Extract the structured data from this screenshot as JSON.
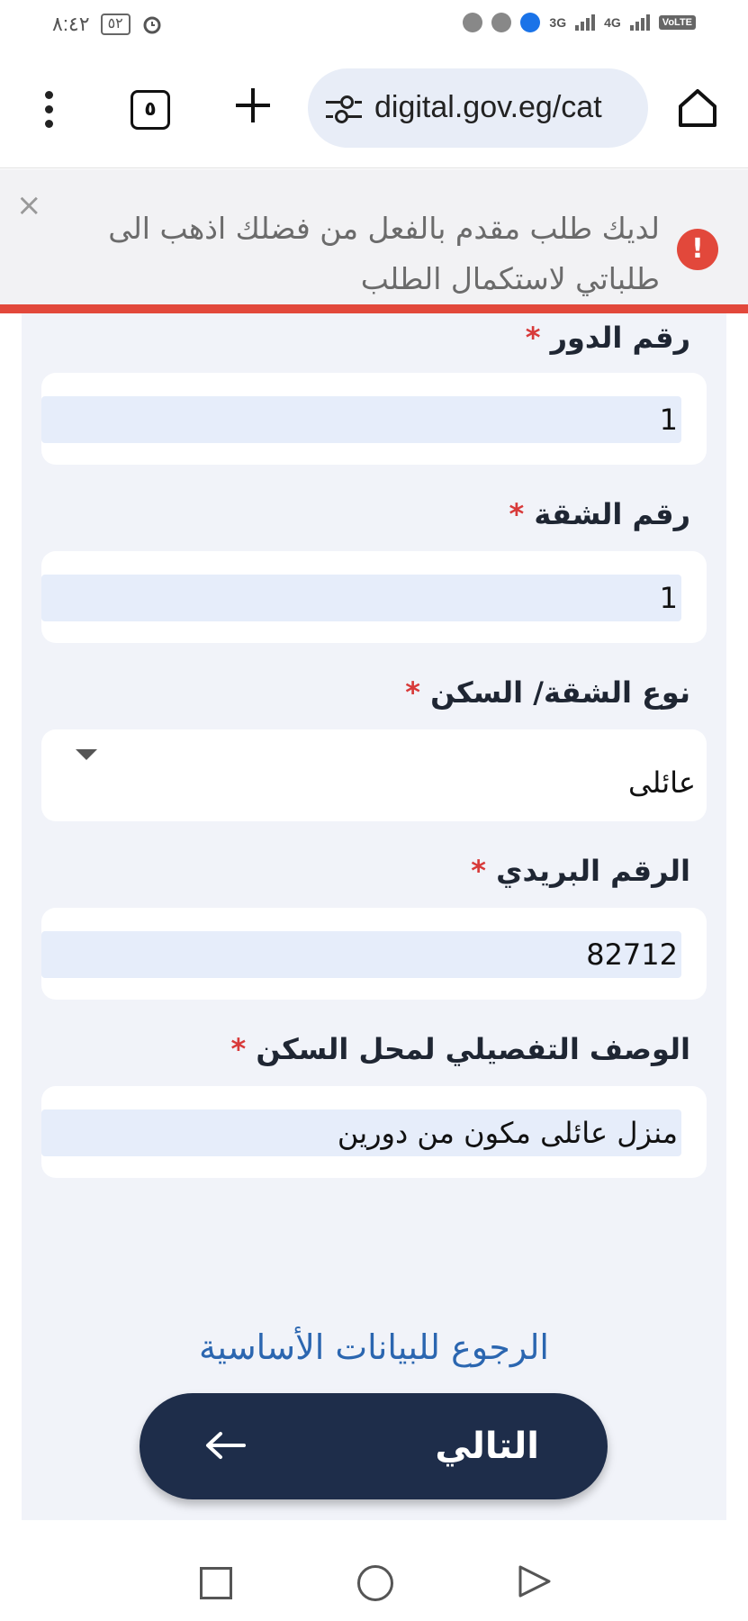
{
  "status_bar": {
    "time": "٨:٤٢",
    "battery": "٥٢",
    "network_3g": "3G",
    "network_4g": "4G",
    "volte": "VoLTE"
  },
  "browser": {
    "tab_count": "٥",
    "url": "digital.gov.eg/cat"
  },
  "alert": {
    "close_symbol": "×",
    "icon_symbol": "!",
    "message": "لديك طلب مقدم بالفعل من فضلك اذهب الى طلباتي لاستكمال الطلب"
  },
  "form": {
    "required_marker": "*",
    "floor": {
      "label": "رقم الدور",
      "value": "1"
    },
    "apartment": {
      "label": "رقم الشقة",
      "value": "1"
    },
    "residence_type": {
      "label": "نوع الشقة/ السكن",
      "value": "عائلى"
    },
    "postal_code": {
      "label": "الرقم البريدي",
      "value": "82712"
    },
    "description": {
      "label": "الوصف التفصيلي لمحل السكن",
      "value": "منزل عائلى مكون من دورين"
    }
  },
  "actions": {
    "back_link": "الرجوع للبيانات الأساسية",
    "next_label": "التالي"
  }
}
